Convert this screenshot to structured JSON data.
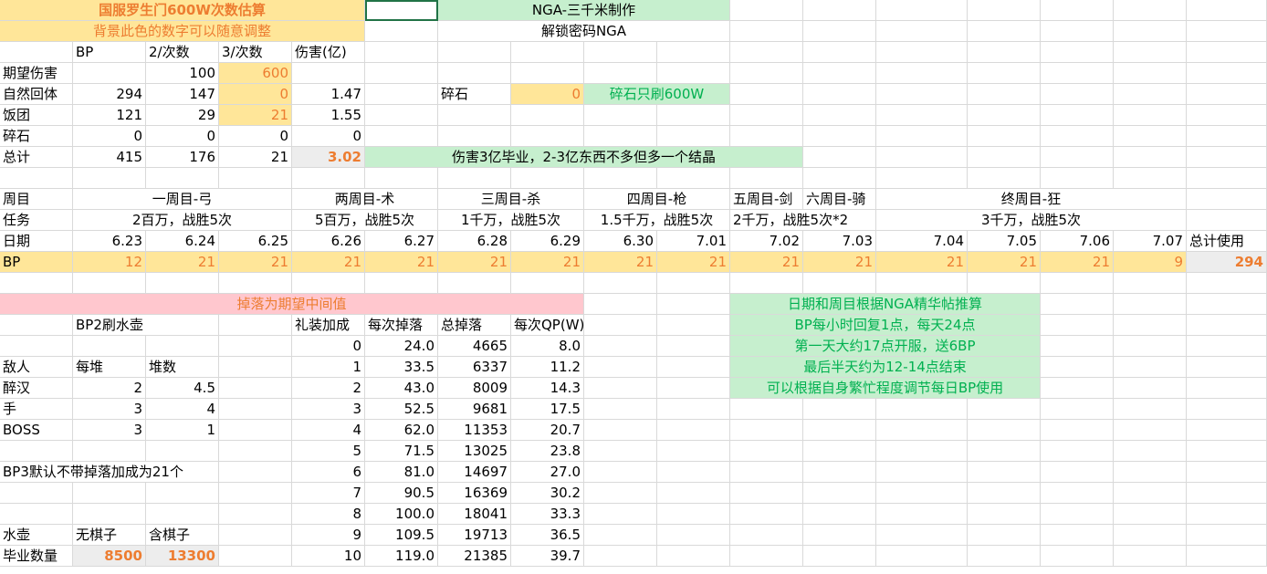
{
  "rows": [
    [
      {
        "t": "国服罗生门600W次数估算",
        "c": 0,
        "s": 5,
        "a": "ce",
        "bg": "y",
        "fg": "or"
      },
      {
        "t": "",
        "c": 5,
        "a": "l",
        "sel": 1
      },
      {
        "t": "NGA-三千米制作",
        "c": 6,
        "s": 4,
        "a": "ce",
        "bg": "gn"
      }
    ],
    [
      {
        "t": "背景此色的数字可以随意调整",
        "c": 0,
        "s": 5,
        "a": "ce",
        "bg": "y",
        "fg": "orn"
      },
      {
        "t": "解锁密码NGA",
        "c": 6,
        "s": 4,
        "a": "ce"
      }
    ],
    [
      {
        "t": "BP",
        "c": 1,
        "a": "l"
      },
      {
        "t": "2/次数",
        "c": 2,
        "a": "l"
      },
      {
        "t": "3/次数",
        "c": 3,
        "a": "l"
      },
      {
        "t": "伤害(亿)",
        "c": 4,
        "a": "l"
      }
    ],
    [
      {
        "t": "期望伤害",
        "c": 0,
        "a": "l"
      },
      {
        "t": "100",
        "c": 2,
        "a": "r"
      },
      {
        "t": "600",
        "c": 3,
        "a": "r",
        "bg": "y",
        "fg": "orn"
      }
    ],
    [
      {
        "t": "自然回体",
        "c": 0,
        "a": "l"
      },
      {
        "t": "294",
        "c": 1,
        "a": "r"
      },
      {
        "t": "147",
        "c": 2,
        "a": "r"
      },
      {
        "t": "0",
        "c": 3,
        "a": "r",
        "bg": "y",
        "fg": "orn"
      },
      {
        "t": "1.47",
        "c": 4,
        "a": "r"
      },
      {
        "t": "碎石",
        "c": 6,
        "a": "l"
      },
      {
        "t": "0",
        "c": 7,
        "a": "r",
        "bg": "y",
        "fg": "orn"
      },
      {
        "t": "碎石只刷600W",
        "c": 8,
        "s": 2,
        "a": "ce",
        "bg": "gn",
        "fg": "gt"
      }
    ],
    [
      {
        "t": "饭团",
        "c": 0,
        "a": "l"
      },
      {
        "t": "121",
        "c": 1,
        "a": "r"
      },
      {
        "t": "29",
        "c": 2,
        "a": "r"
      },
      {
        "t": "21",
        "c": 3,
        "a": "r",
        "bg": "y",
        "fg": "orn"
      },
      {
        "t": "1.55",
        "c": 4,
        "a": "r"
      }
    ],
    [
      {
        "t": "碎石",
        "c": 0,
        "a": "l"
      },
      {
        "t": "0",
        "c": 1,
        "a": "r"
      },
      {
        "t": "0",
        "c": 2,
        "a": "r"
      },
      {
        "t": "0",
        "c": 3,
        "a": "r"
      },
      {
        "t": "0",
        "c": 4,
        "a": "r"
      }
    ],
    [
      {
        "t": "总计",
        "c": 0,
        "a": "l"
      },
      {
        "t": "415",
        "c": 1,
        "a": "r"
      },
      {
        "t": "176",
        "c": 2,
        "a": "r"
      },
      {
        "t": "21",
        "c": 3,
        "a": "r"
      },
      {
        "t": "3.02",
        "c": 4,
        "a": "r",
        "bg": "gy",
        "fg": "or"
      },
      {
        "t": "伤害3亿毕业，2-3亿东西不多但多一个结晶",
        "c": 5,
        "s": 6,
        "a": "ce",
        "bg": "gn"
      }
    ],
    [],
    [
      {
        "t": "周目",
        "c": 0,
        "a": "l"
      },
      {
        "t": "一周目-弓",
        "c": 1,
        "s": 3,
        "a": "ce"
      },
      {
        "t": "两周目-术",
        "c": 4,
        "s": 2,
        "a": "ce"
      },
      {
        "t": "三周目-杀",
        "c": 6,
        "s": 2,
        "a": "ce"
      },
      {
        "t": "四周目-枪",
        "c": 8,
        "s": 2,
        "a": "ce"
      },
      {
        "t": "五周目-剑",
        "c": 10,
        "a": "l"
      },
      {
        "t": "六周目-骑",
        "c": 11,
        "a": "l"
      },
      {
        "t": "终周目-狂",
        "c": 12,
        "s": 4,
        "a": "ce"
      }
    ],
    [
      {
        "t": "任务",
        "c": 0,
        "a": "l"
      },
      {
        "t": "2百万，战胜5次",
        "c": 1,
        "s": 3,
        "a": "ce"
      },
      {
        "t": "5百万，战胜5次",
        "c": 4,
        "s": 2,
        "a": "ce"
      },
      {
        "t": "1千万，战胜5次",
        "c": 6,
        "s": 2,
        "a": "ce"
      },
      {
        "t": "1.5千万，战胜5次",
        "c": 8,
        "s": 2,
        "a": "ce"
      },
      {
        "t": "2千万，战胜5次*2",
        "c": 10,
        "s": 2,
        "a": "l"
      },
      {
        "t": "3千万，战胜5次",
        "c": 12,
        "s": 4,
        "a": "ce"
      }
    ],
    [
      {
        "t": "日期",
        "c": 0,
        "a": "l"
      },
      {
        "t": "6.23",
        "c": 1,
        "a": "r"
      },
      {
        "t": "6.24",
        "c": 2,
        "a": "r"
      },
      {
        "t": "6.25",
        "c": 3,
        "a": "r"
      },
      {
        "t": "6.26",
        "c": 4,
        "a": "r"
      },
      {
        "t": "6.27",
        "c": 5,
        "a": "r"
      },
      {
        "t": "6.28",
        "c": 6,
        "a": "r"
      },
      {
        "t": "6.29",
        "c": 7,
        "a": "r"
      },
      {
        "t": "6.30",
        "c": 8,
        "a": "r"
      },
      {
        "t": "7.01",
        "c": 9,
        "a": "r"
      },
      {
        "t": "7.02",
        "c": 10,
        "a": "r"
      },
      {
        "t": "7.03",
        "c": 11,
        "a": "r"
      },
      {
        "t": "7.04",
        "c": 12,
        "a": "r"
      },
      {
        "t": "7.05",
        "c": 13,
        "a": "r"
      },
      {
        "t": "7.06",
        "c": 14,
        "a": "r"
      },
      {
        "t": "7.07",
        "c": 15,
        "a": "r"
      },
      {
        "t": "总计使用",
        "c": 16,
        "a": "l"
      }
    ],
    [
      {
        "t": "BP",
        "c": 0,
        "a": "l",
        "bg": "y"
      },
      {
        "t": "12",
        "c": 1,
        "a": "r",
        "bg": "y",
        "fg": "orn"
      },
      {
        "t": "21",
        "c": 2,
        "a": "r",
        "bg": "y",
        "fg": "orn"
      },
      {
        "t": "21",
        "c": 3,
        "a": "r",
        "bg": "y",
        "fg": "orn"
      },
      {
        "t": "21",
        "c": 4,
        "a": "r",
        "bg": "y",
        "fg": "orn"
      },
      {
        "t": "21",
        "c": 5,
        "a": "r",
        "bg": "y",
        "fg": "orn"
      },
      {
        "t": "21",
        "c": 6,
        "a": "r",
        "bg": "y",
        "fg": "orn"
      },
      {
        "t": "21",
        "c": 7,
        "a": "r",
        "bg": "y",
        "fg": "orn"
      },
      {
        "t": "21",
        "c": 8,
        "a": "r",
        "bg": "y",
        "fg": "orn"
      },
      {
        "t": "21",
        "c": 9,
        "a": "r",
        "bg": "y",
        "fg": "orn"
      },
      {
        "t": "21",
        "c": 10,
        "a": "r",
        "bg": "y",
        "fg": "orn"
      },
      {
        "t": "21",
        "c": 11,
        "a": "r",
        "bg": "y",
        "fg": "orn"
      },
      {
        "t": "21",
        "c": 12,
        "a": "r",
        "bg": "y",
        "fg": "orn"
      },
      {
        "t": "21",
        "c": 13,
        "a": "r",
        "bg": "y",
        "fg": "orn"
      },
      {
        "t": "21",
        "c": 14,
        "a": "r",
        "bg": "y",
        "fg": "orn"
      },
      {
        "t": "9",
        "c": 15,
        "a": "r",
        "bg": "y",
        "fg": "orn"
      },
      {
        "t": "294",
        "c": 16,
        "a": "r",
        "bg": "gy",
        "fg": "or"
      }
    ],
    [],
    [
      {
        "t": "掉落为期望中间值",
        "c": 0,
        "s": 8,
        "a": "ce",
        "bg": "pk",
        "fg": "orn"
      },
      {
        "t": "日期和周目根据NGA精华帖推算",
        "c": 10,
        "s": 4,
        "a": "ce",
        "bg": "gn",
        "fg": "gt"
      }
    ],
    [
      {
        "t": "BP2刷水壶",
        "c": 1,
        "s": 2,
        "a": "l"
      },
      {
        "t": "礼装加成",
        "c": 4,
        "a": "l"
      },
      {
        "t": "每次掉落",
        "c": 5,
        "a": "l"
      },
      {
        "t": "总掉落",
        "c": 6,
        "a": "l"
      },
      {
        "t": "每次QP(W)",
        "c": 7,
        "a": "l"
      },
      {
        "t": "BP每小时回复1点，每天24点",
        "c": 10,
        "s": 4,
        "a": "ce",
        "bg": "gn",
        "fg": "gt"
      }
    ],
    [
      {
        "t": "0",
        "c": 4,
        "a": "r"
      },
      {
        "t": "24.0",
        "c": 5,
        "a": "r"
      },
      {
        "t": "4665",
        "c": 6,
        "a": "r"
      },
      {
        "t": "8.0",
        "c": 7,
        "a": "r"
      },
      {
        "t": "第一天大约17点开服，送6BP",
        "c": 10,
        "s": 4,
        "a": "ce",
        "bg": "gn",
        "fg": "gt"
      }
    ],
    [
      {
        "t": "敌人",
        "c": 0,
        "a": "l"
      },
      {
        "t": "每堆",
        "c": 1,
        "a": "l"
      },
      {
        "t": "堆数",
        "c": 2,
        "a": "l"
      },
      {
        "t": "1",
        "c": 4,
        "a": "r"
      },
      {
        "t": "33.5",
        "c": 5,
        "a": "r"
      },
      {
        "t": "6337",
        "c": 6,
        "a": "r"
      },
      {
        "t": "11.2",
        "c": 7,
        "a": "r"
      },
      {
        "t": "最后半天约为12-14点结束",
        "c": 10,
        "s": 4,
        "a": "ce",
        "bg": "gn",
        "fg": "gt"
      }
    ],
    [
      {
        "t": "醉汉",
        "c": 0,
        "a": "l"
      },
      {
        "t": "2",
        "c": 1,
        "a": "r"
      },
      {
        "t": "4.5",
        "c": 2,
        "a": "r"
      },
      {
        "t": "2",
        "c": 4,
        "a": "r"
      },
      {
        "t": "43.0",
        "c": 5,
        "a": "r"
      },
      {
        "t": "8009",
        "c": 6,
        "a": "r"
      },
      {
        "t": "14.3",
        "c": 7,
        "a": "r"
      },
      {
        "t": "可以根据自身繁忙程度调节每日BP使用",
        "c": 10,
        "s": 4,
        "a": "ce",
        "bg": "gn",
        "fg": "gt"
      }
    ],
    [
      {
        "t": "手",
        "c": 0,
        "a": "l"
      },
      {
        "t": "3",
        "c": 1,
        "a": "r"
      },
      {
        "t": "4",
        "c": 2,
        "a": "r"
      },
      {
        "t": "3",
        "c": 4,
        "a": "r"
      },
      {
        "t": "52.5",
        "c": 5,
        "a": "r"
      },
      {
        "t": "9681",
        "c": 6,
        "a": "r"
      },
      {
        "t": "17.5",
        "c": 7,
        "a": "r"
      }
    ],
    [
      {
        "t": "BOSS",
        "c": 0,
        "a": "l"
      },
      {
        "t": "3",
        "c": 1,
        "a": "r"
      },
      {
        "t": "1",
        "c": 2,
        "a": "r"
      },
      {
        "t": "4",
        "c": 4,
        "a": "r"
      },
      {
        "t": "62.0",
        "c": 5,
        "a": "r"
      },
      {
        "t": "11353",
        "c": 6,
        "a": "r"
      },
      {
        "t": "20.7",
        "c": 7,
        "a": "r"
      }
    ],
    [
      {
        "t": "5",
        "c": 4,
        "a": "r"
      },
      {
        "t": "71.5",
        "c": 5,
        "a": "r"
      },
      {
        "t": "13025",
        "c": 6,
        "a": "r"
      },
      {
        "t": "23.8",
        "c": 7,
        "a": "r"
      }
    ],
    [
      {
        "t": "BP3默认不带掉落加成为21个",
        "c": 0,
        "s": 3,
        "a": "l"
      },
      {
        "t": "6",
        "c": 4,
        "a": "r"
      },
      {
        "t": "81.0",
        "c": 5,
        "a": "r"
      },
      {
        "t": "14697",
        "c": 6,
        "a": "r"
      },
      {
        "t": "27.0",
        "c": 7,
        "a": "r"
      }
    ],
    [
      {
        "t": "7",
        "c": 4,
        "a": "r"
      },
      {
        "t": "90.5",
        "c": 5,
        "a": "r"
      },
      {
        "t": "16369",
        "c": 6,
        "a": "r"
      },
      {
        "t": "30.2",
        "c": 7,
        "a": "r"
      }
    ],
    [
      {
        "t": "8",
        "c": 4,
        "a": "r"
      },
      {
        "t": "100.0",
        "c": 5,
        "a": "r"
      },
      {
        "t": "18041",
        "c": 6,
        "a": "r"
      },
      {
        "t": "33.3",
        "c": 7,
        "a": "r"
      }
    ],
    [
      {
        "t": "水壶",
        "c": 0,
        "a": "l"
      },
      {
        "t": "无棋子",
        "c": 1,
        "a": "l"
      },
      {
        "t": "含棋子",
        "c": 2,
        "a": "l"
      },
      {
        "t": "9",
        "c": 4,
        "a": "r"
      },
      {
        "t": "109.5",
        "c": 5,
        "a": "r"
      },
      {
        "t": "19713",
        "c": 6,
        "a": "r"
      },
      {
        "t": "36.5",
        "c": 7,
        "a": "r"
      }
    ],
    [
      {
        "t": "毕业数量",
        "c": 0,
        "a": "l"
      },
      {
        "t": "8500",
        "c": 1,
        "a": "r",
        "bg": "gy",
        "fg": "or"
      },
      {
        "t": "13300",
        "c": 2,
        "a": "r",
        "bg": "gy",
        "fg": "or"
      },
      {
        "t": "10",
        "c": 4,
        "a": "r"
      },
      {
        "t": "119.0",
        "c": 5,
        "a": "r"
      },
      {
        "t": "21385",
        "c": 6,
        "a": "r"
      },
      {
        "t": "39.7",
        "c": 7,
        "a": "r"
      }
    ]
  ]
}
